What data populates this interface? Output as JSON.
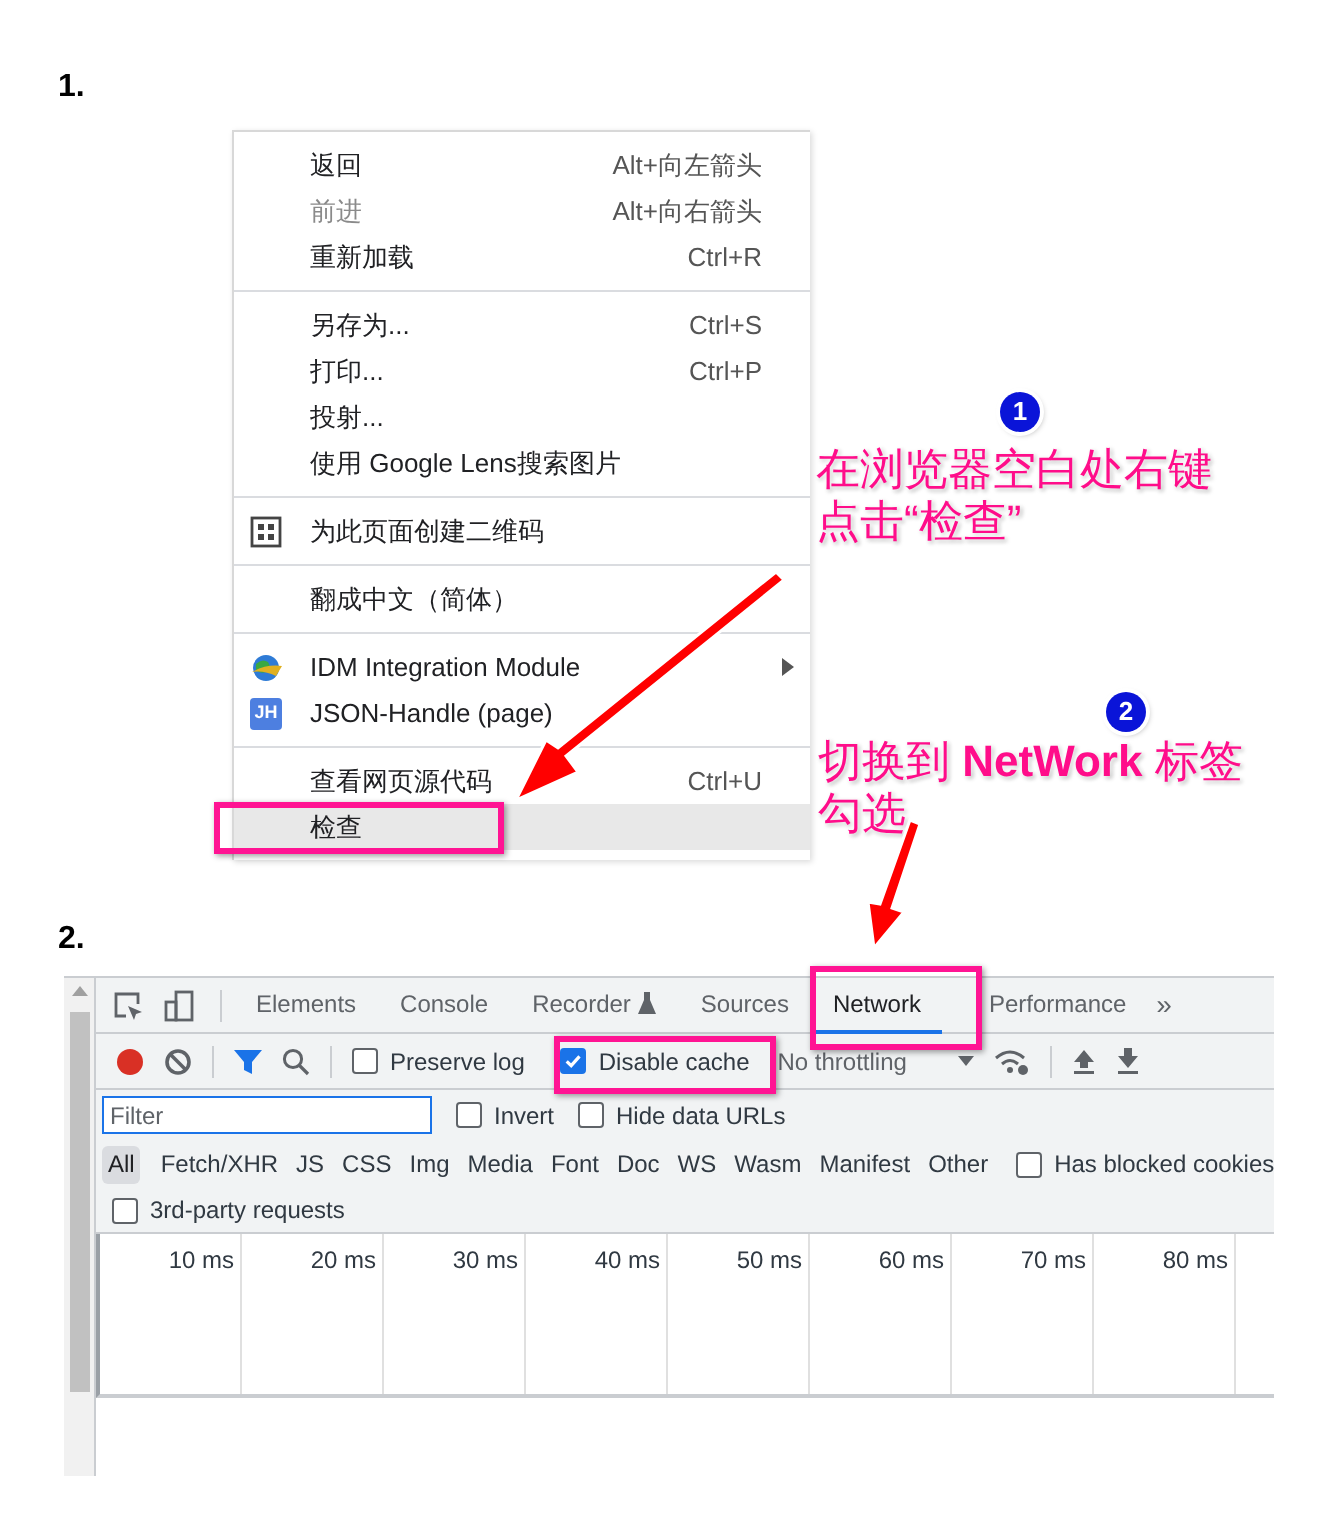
{
  "section_1": {
    "number": "1.",
    "context_menu": {
      "groups": [
        [
          {
            "label": "返回",
            "shortcut": "Alt+向左箭头",
            "disabled": false,
            "highlighted": false
          },
          {
            "label": "前进",
            "shortcut": "Alt+向右箭头",
            "disabled": true,
            "highlighted": false
          },
          {
            "label": "重新加载",
            "shortcut": "Ctrl+R",
            "disabled": false,
            "highlighted": false
          }
        ],
        [
          {
            "label": "另存为...",
            "shortcut": "Ctrl+S",
            "disabled": false,
            "highlighted": false
          },
          {
            "label": "打印...",
            "shortcut": "Ctrl+P",
            "disabled": false,
            "highlighted": false
          },
          {
            "label": "投射...",
            "disabled": false,
            "highlighted": false
          },
          {
            "label": "使用 Google Lens搜索图片",
            "disabled": false,
            "highlighted": false
          }
        ],
        [
          {
            "label": "为此页面创建二维码",
            "kind": "qr",
            "disabled": false,
            "highlighted": false
          }
        ],
        [
          {
            "label": "翻成中文（简体）",
            "disabled": false,
            "highlighted": false
          }
        ],
        [
          {
            "label": "IDM Integration Module",
            "kind": "extension",
            "submenu": true,
            "disabled": false,
            "highlighted": false
          },
          {
            "label": "JSON-Handle (page)",
            "kind": "badge",
            "icon_text": "JH",
            "disabled": false,
            "highlighted": false
          }
        ],
        [
          {
            "label": "查看网页源代码",
            "shortcut": "Ctrl+U",
            "disabled": false,
            "highlighted": false
          },
          {
            "label": "检查",
            "disabled": false,
            "highlighted": true
          }
        ]
      ]
    }
  },
  "section_2": {
    "number": "2.",
    "devtools": {
      "tabs": [
        {
          "label": "Elements",
          "selected": false
        },
        {
          "label": "Console",
          "selected": false
        },
        {
          "label": "Recorder",
          "flask": true,
          "selected": false
        },
        {
          "label": "Sources",
          "selected": false
        },
        {
          "label": "Network",
          "selected": true
        },
        {
          "label": "Performance",
          "selected": false
        }
      ],
      "more_tabs": "»",
      "preserve_log": {
        "label": "Preserve log",
        "checked": false
      },
      "disable_cache": {
        "label": "Disable cache",
        "checked": true
      },
      "throttling": "No throttling",
      "filter": {
        "placeholder": "Filter"
      },
      "invert": {
        "label": "Invert",
        "checked": false
      },
      "hide_data_urls": {
        "label": "Hide data URLs",
        "checked": false
      },
      "types": [
        {
          "label": "All",
          "selected": true
        },
        {
          "label": "Fetch/XHR",
          "selected": false
        },
        {
          "label": "JS",
          "selected": false
        },
        {
          "label": "CSS",
          "selected": false
        },
        {
          "label": "Img",
          "selected": false
        },
        {
          "label": "Media",
          "selected": false
        },
        {
          "label": "Font",
          "selected": false
        },
        {
          "label": "Doc",
          "selected": false
        },
        {
          "label": "WS",
          "selected": false
        },
        {
          "label": "Wasm",
          "selected": false
        },
        {
          "label": "Manifest",
          "selected": false
        },
        {
          "label": "Other",
          "selected": false
        }
      ],
      "blocked_cookies": {
        "label": "Has blocked cookies",
        "checked": false
      },
      "third_party": {
        "label": "3rd-party requests",
        "checked": false
      },
      "timeline": [
        "10 ms",
        "20 ms",
        "30 ms",
        "40 ms",
        "50 ms",
        "60 ms",
        "70 ms",
        "80 ms"
      ]
    }
  },
  "annotations": [
    {
      "step": "1",
      "lines": [
        "在浏览器空白处右键",
        "点击“检查”"
      ]
    },
    {
      "step": "2",
      "lines": [
        "切换到 **NetWork** 标签",
        "勾选"
      ]
    }
  ]
}
